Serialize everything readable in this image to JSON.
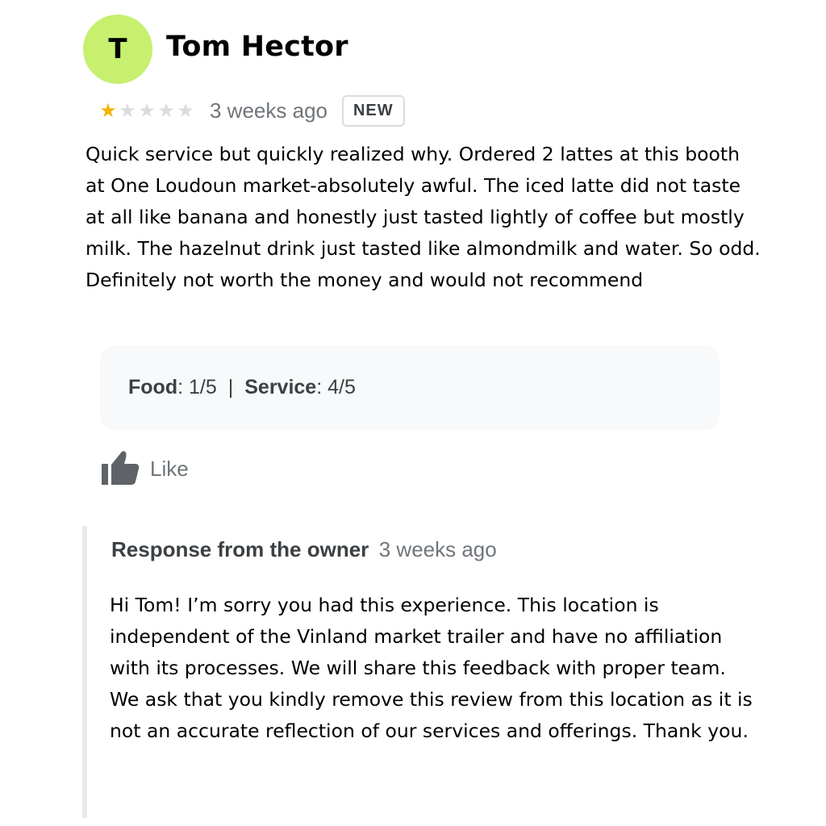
{
  "reviewer": {
    "initial": "T",
    "name": "Tom Hector",
    "avatar_color": "#c6f06e"
  },
  "rating": {
    "stars": 1,
    "max": 5,
    "time": "3 weeks ago",
    "badge": "NEW",
    "star_color": "#f4b400"
  },
  "review": {
    "text": "Quick service but quickly realized why. Ordered 2 lattes at this booth at One Loudoun market-absolutely awful. The iced latte did not taste at all like banana and honestly just tasted lightly of coffee but mostly milk. The hazelnut drink just tasted like almondmilk and water. So odd. Definitely not worth the money and would not recommend"
  },
  "subratings": {
    "food_label": "Food",
    "food_value": ": 1/5",
    "separator": "|",
    "service_label": "Service",
    "service_value": ": 4/5"
  },
  "actions": {
    "like_label": "Like",
    "like_icon": "thumbs-up-icon"
  },
  "owner_response": {
    "title": "Response from the owner",
    "time": "3 weeks ago",
    "text": "Hi Tom! I’m sorry you had this experience. This location is independent of the Vinland market trailer and have no affiliation with its processes. We will share this feedback with proper team. We ask that you kindly remove this review from this location as it is not an accurate reflection of our services and offerings. Thank you."
  }
}
